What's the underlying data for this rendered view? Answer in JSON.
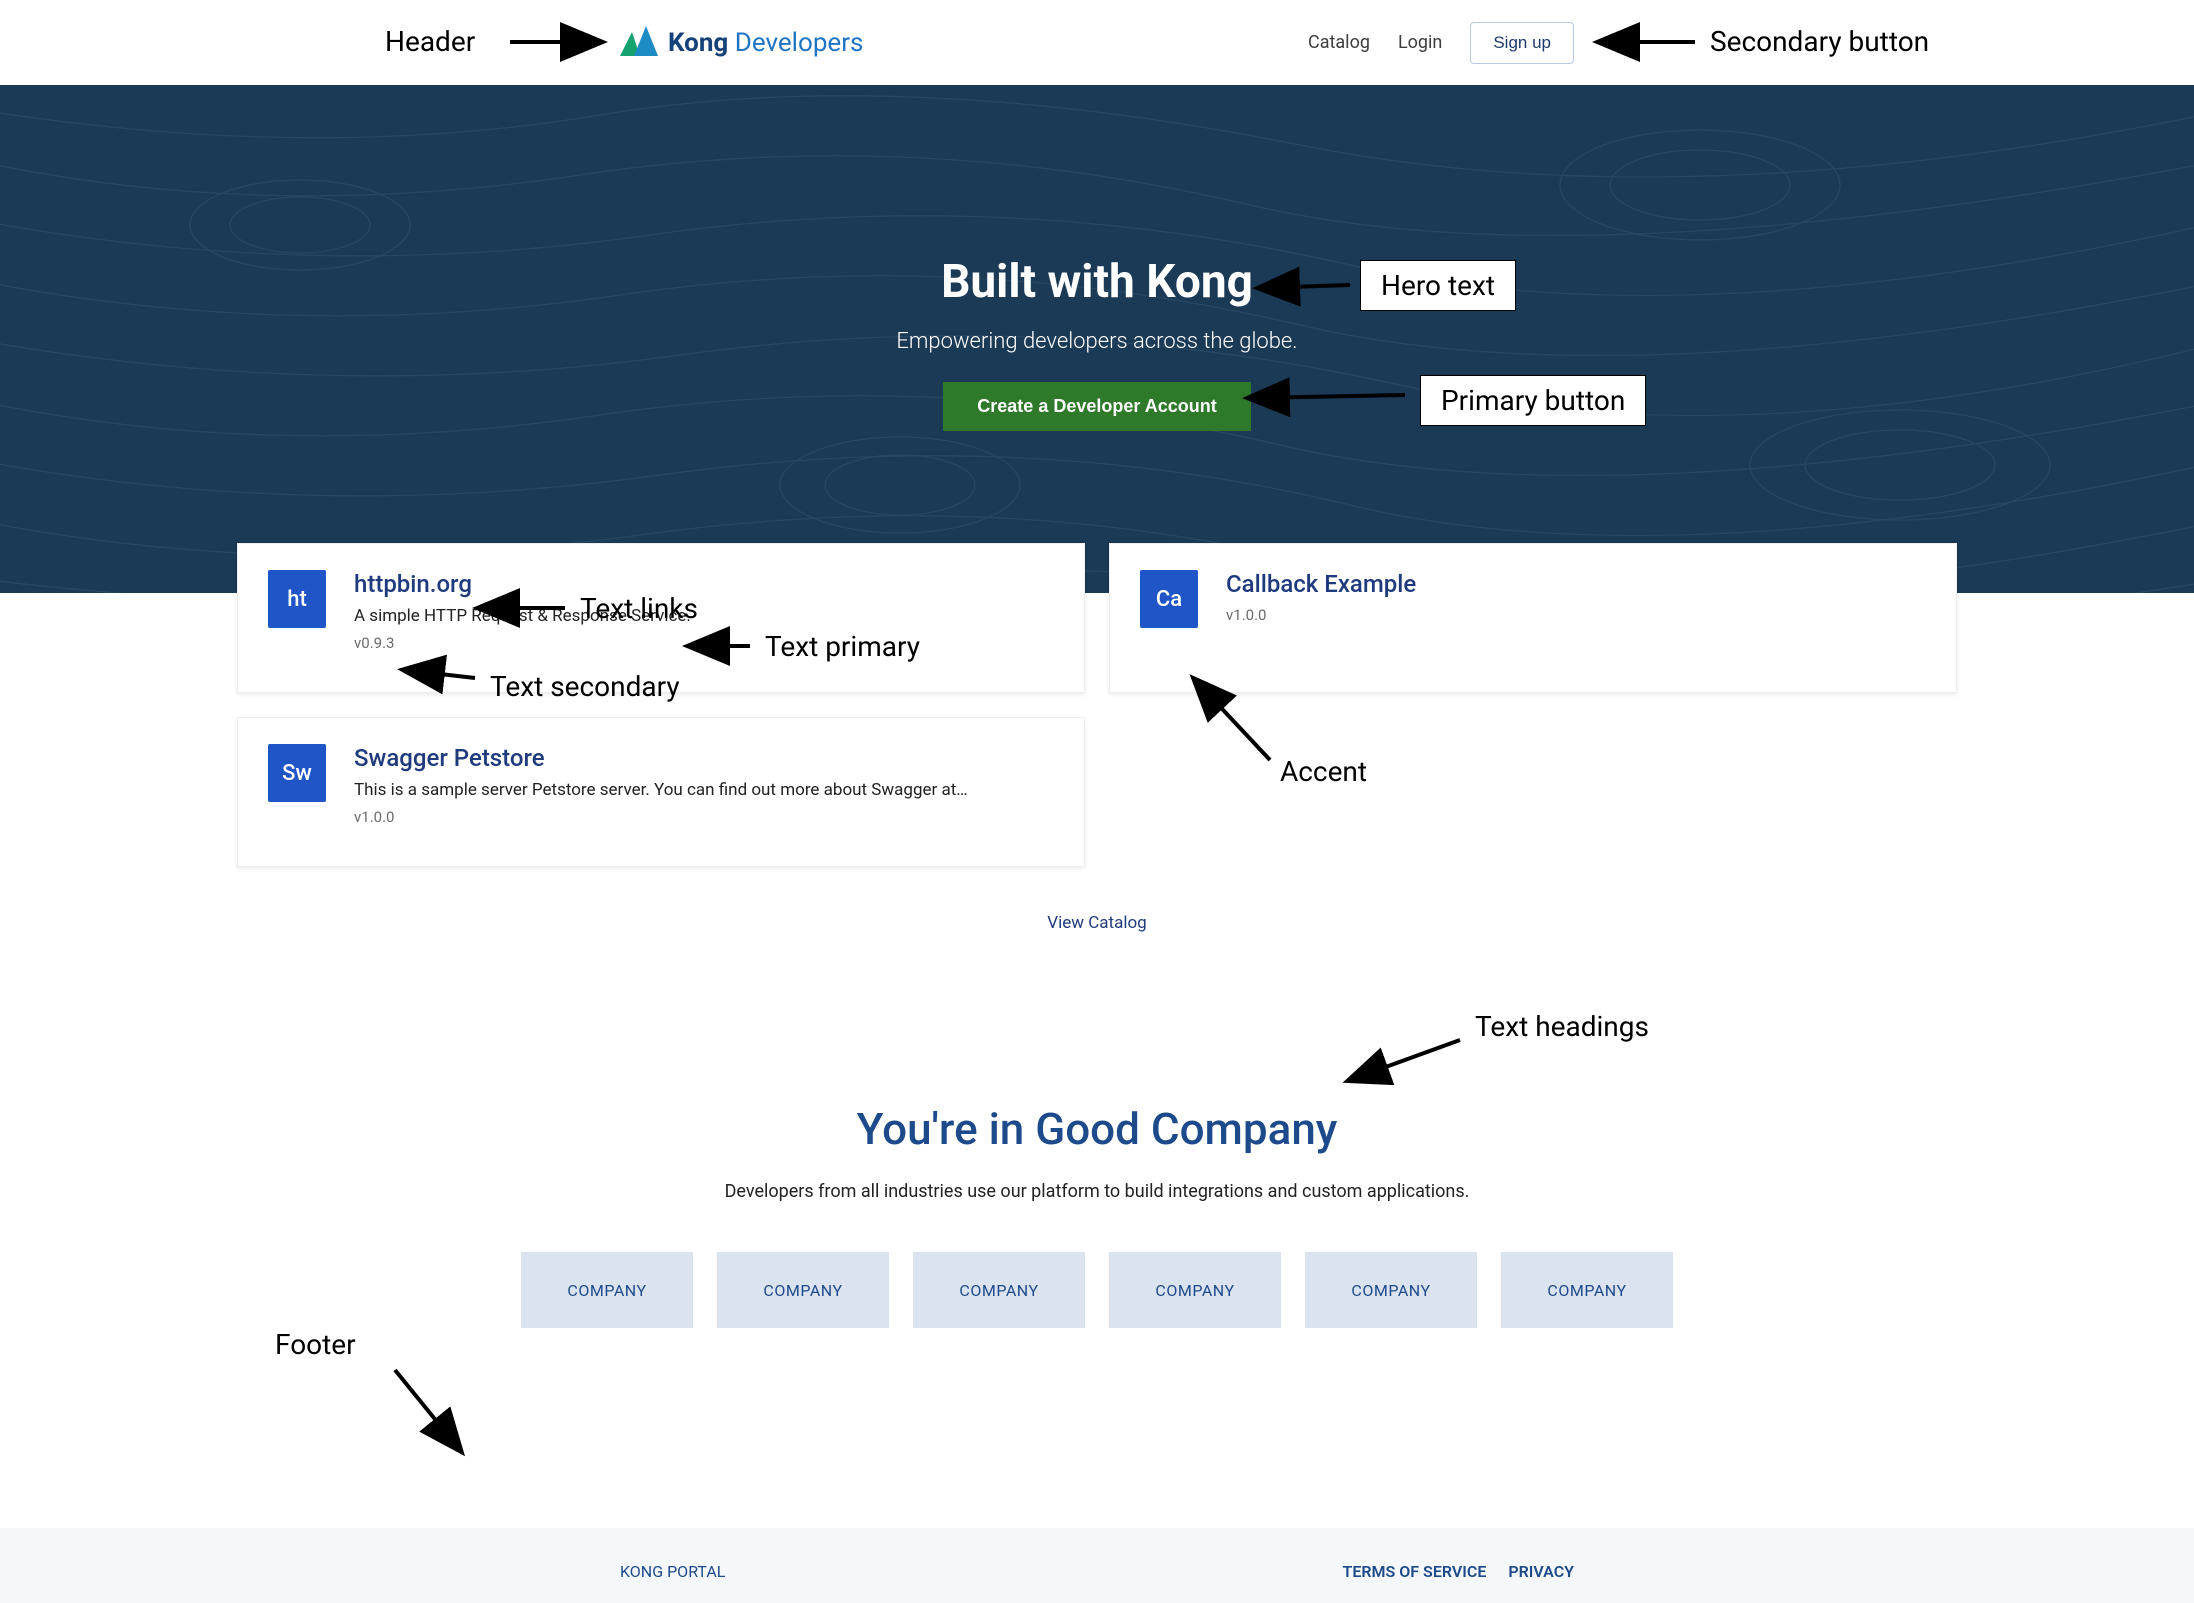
{
  "header": {
    "logo_brand": "Kong",
    "logo_sub": "Developers",
    "nav": {
      "catalog": "Catalog",
      "login": "Login",
      "signup": "Sign up"
    }
  },
  "hero": {
    "title": "Built with Kong",
    "subtitle": "Empowering developers across the globe.",
    "cta": "Create a Developer Account"
  },
  "cards": [
    {
      "abbrev": "ht",
      "title": "httpbin.org",
      "desc": "A simple HTTP Request & Response Service.",
      "version": "v0.9.3"
    },
    {
      "abbrev": "Ca",
      "title": "Callback Example",
      "desc": "",
      "version": "v1.0.0"
    },
    {
      "abbrev": "Sw",
      "title": "Swagger Petstore",
      "desc": "This is a sample server Petstore server. You can find out more about Swagger at…",
      "version": "v1.0.0"
    }
  ],
  "view_catalog": "View Catalog",
  "companies": {
    "heading": "You're in Good Company",
    "sub": "Developers from all industries use our platform to build integrations and custom applications.",
    "tile_label": "COMPANY",
    "count": 6
  },
  "footer": {
    "brand": "KONG PORTAL",
    "tos": "TERMS OF SERVICE",
    "privacy": "PRIVACY"
  },
  "annotations": {
    "header": "Header",
    "secondary_btn": "Secondary button",
    "hero_text": "Hero text",
    "primary_btn": "Primary button",
    "text_links": "Text links",
    "text_primary": "Text primary",
    "text_secondary": "Text secondary",
    "accent": "Accent",
    "text_headings": "Text headings",
    "footer": "Footer"
  },
  "colors": {
    "hero_bg": "#1b3a56",
    "accent": "#1f55c6",
    "primary_button": "#2f7a2a",
    "heading": "#1d4a8a"
  }
}
